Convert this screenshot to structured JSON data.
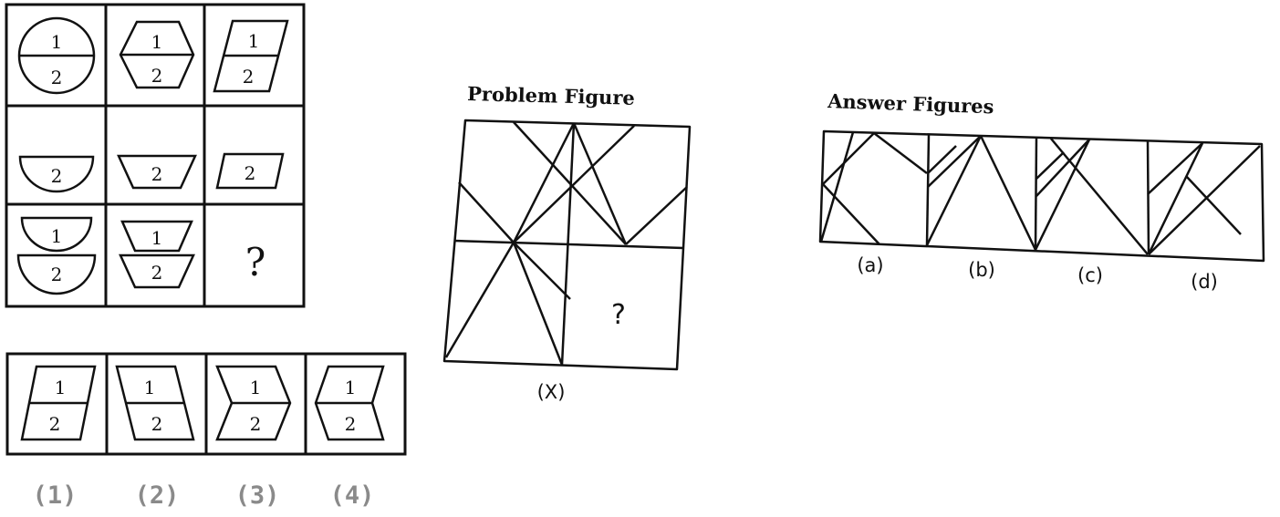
{
  "puzzle1": {
    "grid_texts": {
      "n1": "1",
      "n2": "2",
      "question": "?"
    },
    "options": [
      "(1)",
      "(2)",
      "(3)",
      "(4)"
    ]
  },
  "puzzle2": {
    "problem_heading": "Problem Figure",
    "problem_question": "?",
    "problem_label": "(X)",
    "answer_heading": "Answer Figures",
    "answers": [
      "(a)",
      "(b)",
      "(c)",
      "(d)"
    ]
  }
}
